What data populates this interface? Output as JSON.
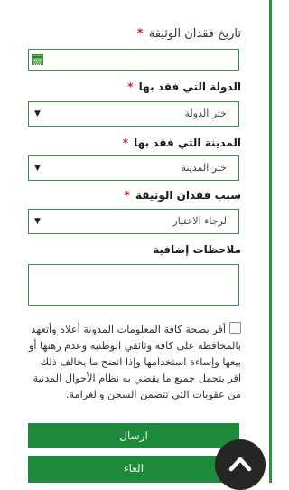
{
  "form": {
    "loss_date_label": "تاريخ فقدان الوثيقة",
    "required_mark": "*",
    "loss_date_value": "",
    "country_label": "الدولة التي فقد بها",
    "country_value": "اختر الدولة",
    "city_label": "المدينة التي فقد بها",
    "city_value": "اختر المدينة",
    "reason_label": "سبب فقدان الوثيقة",
    "reason_value": "الرجاء الاختيار",
    "notes_label": "ملاحظات إضافية",
    "notes_value": "",
    "consent_text": "أقر بصحة كافة المعلومات المدونة أعلاه وأتعهد بالمحافظة على كافة وثائقي الوطنية وعدم رهنها أو بيعها وإساءة استخدامها وإذا اتضح ما يخالف ذلك اقر بتحمل جميع ما يقضي به نظام الأحوال المدنية من عقوبات التي تتضمن السجن والغرامة.",
    "consent_checked": false,
    "submit_label": "ارسال",
    "cancel_label": "الغاء"
  },
  "icons": {
    "calendar": "calendar-icon",
    "dropdown": "caret-down-icon",
    "scroll_top": "arrow-up-icon"
  },
  "colors": {
    "primary_green": "#1d8a3c",
    "field_border": "#2b8f45",
    "required": "#c0282d"
  }
}
